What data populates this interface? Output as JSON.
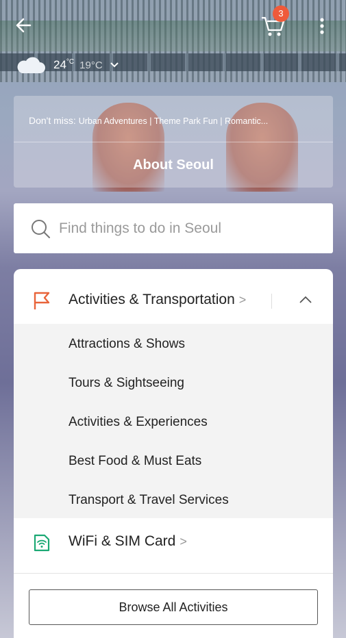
{
  "header": {
    "cart_count": "3"
  },
  "weather": {
    "high": "24",
    "high_unit": "°C",
    "low": "19°C"
  },
  "promo": {
    "dont_miss_label": "Don't miss:",
    "links": "Urban Adventures | Theme Park Fun | Romantic..."
  },
  "about_label": "About Seoul",
  "search": {
    "placeholder": "Find things to do in Seoul"
  },
  "category": {
    "label": "Activities & Transportation",
    "chevron": ">",
    "accent": "#e8643a"
  },
  "subcategories": [
    "Attractions & Shows",
    "Tours & Sightseeing",
    "Activities & Experiences",
    "Best Food & Must Eats",
    "Transport & Travel Services"
  ],
  "wifi": {
    "label": "WiFi & SIM Card",
    "chevron": ">",
    "accent": "#1aa873"
  },
  "browse_button": "Browse All Activities"
}
